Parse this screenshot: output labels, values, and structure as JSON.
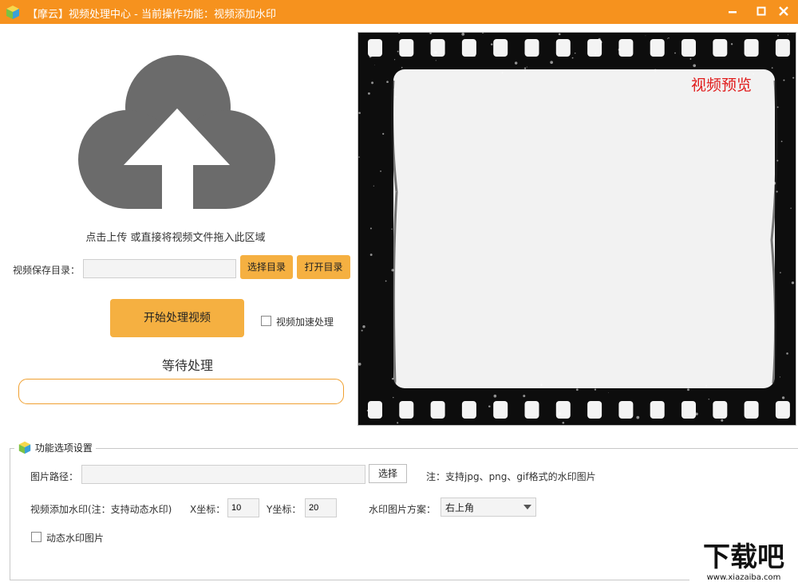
{
  "window": {
    "title": "【摩云】视频处理中心 - 当前操作功能：视频添加水印",
    "controls": {
      "minimize": "–",
      "maximize": "□",
      "close": "✕"
    }
  },
  "upload": {
    "icon": "cloud-upload-icon",
    "hint": "点击上传 或直接将视频文件拖入此区域"
  },
  "save_dir": {
    "label": "视频保存目录：",
    "value": "",
    "choose_label": "选择目录",
    "open_label": "打开目录"
  },
  "process": {
    "start_label": "开始处理视频",
    "accelerate_label": "视频加速处理",
    "accelerate_checked": false,
    "status": "等待处理",
    "progress": 0
  },
  "preview": {
    "label": "视频预览"
  },
  "options": {
    "legend": "功能选项设置",
    "image_path_label": "图片路径：",
    "image_path_value": "",
    "choose_label": "选择",
    "note": "注：支持jpg、png、gif格式的水印图片",
    "watermark_label": "视频添加水印(注：支持动态水印)",
    "x_label": "X坐标：",
    "x_value": "10",
    "y_label": "Y坐标：",
    "y_value": "20",
    "scheme_label": "水印图片方案：",
    "scheme_value": "右上角",
    "dynamic_label": "动态水印图片",
    "dynamic_checked": false
  },
  "badge": {
    "text": "下载吧",
    "url_text": "www.xiazaiba.com"
  },
  "colors": {
    "accent": "#f6921e",
    "button": "#f5b041",
    "preview_text": "#e01b1b"
  }
}
